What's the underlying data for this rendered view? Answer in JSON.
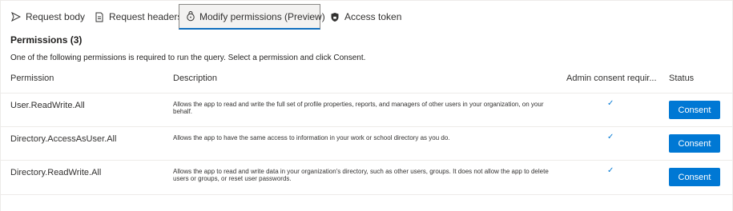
{
  "tabs": [
    {
      "label": "Request body",
      "icon": "send-icon",
      "active": false
    },
    {
      "label": "Request headers",
      "icon": "document-icon",
      "active": false
    },
    {
      "label": "Modify permissions (Preview)",
      "icon": "lock-icon",
      "active": true
    },
    {
      "label": "Access token",
      "icon": "shield-lock-icon",
      "active": false
    }
  ],
  "section": {
    "title": "Permissions (3)",
    "instructions": "One of the following permissions is required to run the query. Select a permission and click Consent."
  },
  "table": {
    "headers": {
      "permission": "Permission",
      "description": "Description",
      "admin_consent": "Admin consent requir...",
      "status": "Status"
    },
    "rows": [
      {
        "permission": "User.ReadWrite.All",
        "description": "Allows the app to read and write the full set of profile properties, reports, and managers of other users in your organization, on your behalf.",
        "admin_consent": "✓",
        "button": "Consent"
      },
      {
        "permission": "Directory.AccessAsUser.All",
        "description": "Allows the app to have the same access to information in your work or school directory as you do.",
        "admin_consent": "✓",
        "button": "Consent"
      },
      {
        "permission": "Directory.ReadWrite.All",
        "description": "Allows the app to read and write data in your organization's directory, such as other users, groups. It does not allow the app to delete users or groups, or reset user passwords.",
        "admin_consent": "✓",
        "button": "Consent"
      }
    ]
  },
  "colors": {
    "accent": "#0078d4",
    "active_tab_underline": "#106ebe",
    "divider": "#edebe9"
  }
}
